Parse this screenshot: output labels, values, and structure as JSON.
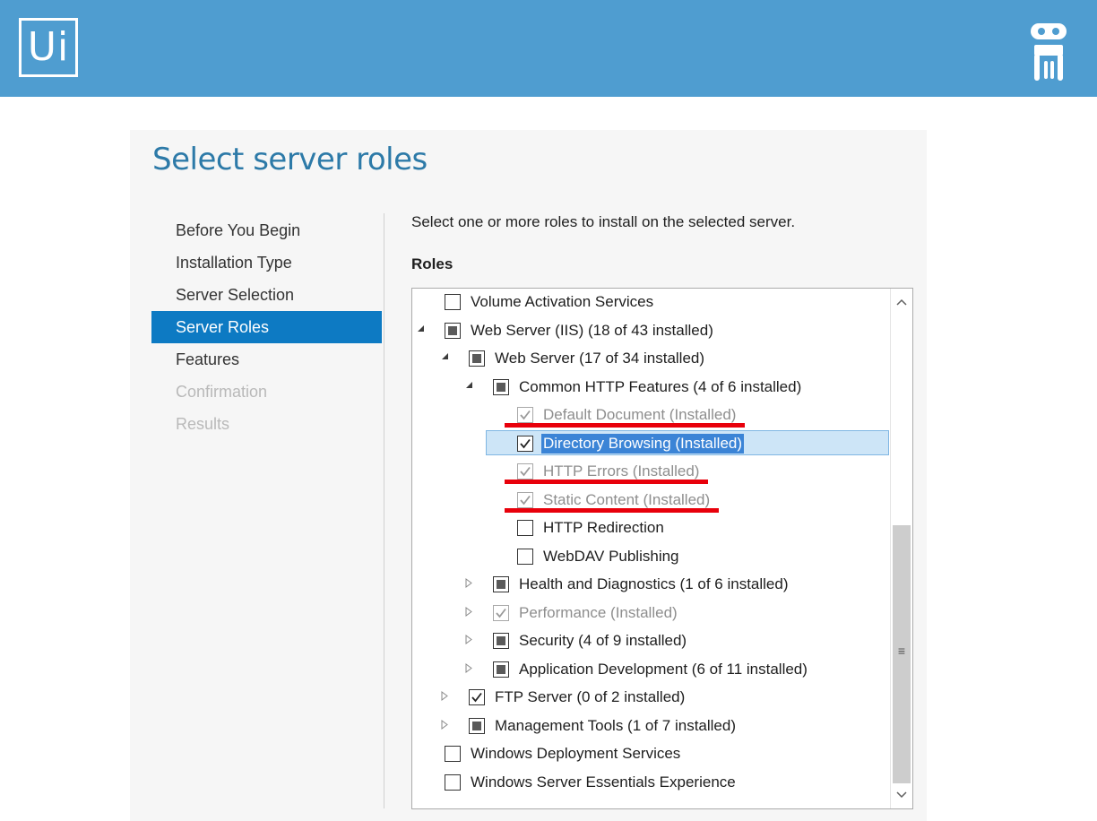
{
  "header": {
    "logo_text": "Ui",
    "robot_icon": "robot-icon",
    "bg_color": "#4f9dd0"
  },
  "title": "Select server roles",
  "nav": [
    {
      "label": "Before You Begin",
      "state": "normal"
    },
    {
      "label": "Installation Type",
      "state": "normal"
    },
    {
      "label": "Server Selection",
      "state": "normal"
    },
    {
      "label": "Server Roles",
      "state": "active"
    },
    {
      "label": "Features",
      "state": "normal"
    },
    {
      "label": "Confirmation",
      "state": "disabled"
    },
    {
      "label": "Results",
      "state": "disabled"
    }
  ],
  "instruction": "Select one or more roles to install on the selected server.",
  "roles_heading": "Roles",
  "roles": [
    {
      "label": "Volume Activation Services",
      "level": 0,
      "expander": "none",
      "check": "unchecked",
      "grey": false
    },
    {
      "label": "Web Server (IIS) (18 of 43 installed)",
      "level": 0,
      "expander": "expanded",
      "check": "partial",
      "grey": false
    },
    {
      "label": "Web Server (17 of 34 installed)",
      "level": 1,
      "expander": "expanded",
      "check": "partial",
      "grey": false
    },
    {
      "label": "Common HTTP Features (4 of 6 installed)",
      "level": 2,
      "expander": "expanded",
      "check": "partial",
      "grey": false
    },
    {
      "label": "Default Document (Installed)",
      "level": 3,
      "expander": "none",
      "check": "checked",
      "grey": true,
      "underline": true
    },
    {
      "label": "Directory Browsing (Installed)",
      "level": 3,
      "expander": "none",
      "check": "checked",
      "grey": false,
      "selected": true
    },
    {
      "label": "HTTP Errors (Installed)",
      "level": 3,
      "expander": "none",
      "check": "checked",
      "grey": true,
      "underline": true
    },
    {
      "label": "Static Content (Installed)",
      "level": 3,
      "expander": "none",
      "check": "checked",
      "grey": true,
      "underline": true
    },
    {
      "label": "HTTP Redirection",
      "level": 3,
      "expander": "none",
      "check": "unchecked",
      "grey": false
    },
    {
      "label": "WebDAV Publishing",
      "level": 3,
      "expander": "none",
      "check": "unchecked",
      "grey": false
    },
    {
      "label": "Health and Diagnostics (1 of 6 installed)",
      "level": 2,
      "expander": "collapsed",
      "check": "partial",
      "grey": false
    },
    {
      "label": "Performance (Installed)",
      "level": 2,
      "expander": "collapsed",
      "check": "checked",
      "grey": true
    },
    {
      "label": "Security (4 of 9 installed)",
      "level": 2,
      "expander": "collapsed",
      "check": "partial",
      "grey": false
    },
    {
      "label": "Application Development (6 of 11 installed)",
      "level": 2,
      "expander": "collapsed",
      "check": "partial",
      "grey": false
    },
    {
      "label": "FTP Server (0 of 2 installed)",
      "level": 1,
      "expander": "collapsed",
      "check": "checked",
      "grey": false
    },
    {
      "label": "Management Tools (1 of 7 installed)",
      "level": 1,
      "expander": "collapsed",
      "check": "partial",
      "grey": false
    },
    {
      "label": "Windows Deployment Services",
      "level": 0,
      "expander": "none",
      "check": "unchecked",
      "grey": false
    },
    {
      "label": "Windows Server Essentials Experience",
      "level": 0,
      "expander": "none",
      "check": "unchecked",
      "grey": false
    }
  ],
  "scrollbar": {
    "up_icon": "chevron-up-icon",
    "down_icon": "chevron-down-icon",
    "grip_icon": "grip-icon"
  },
  "colors": {
    "accent": "#0d7ac3",
    "highlight": "#e8000b",
    "selection": "#cde5f7"
  }
}
